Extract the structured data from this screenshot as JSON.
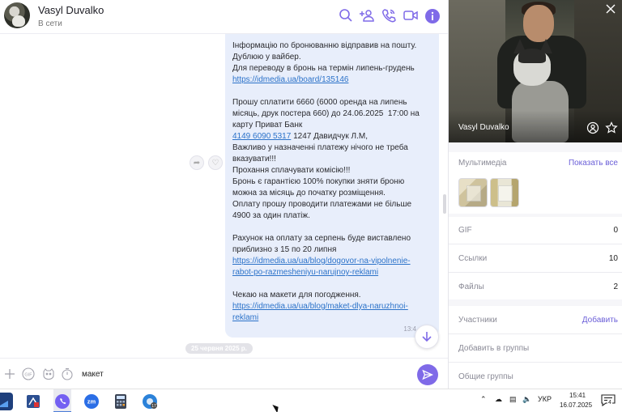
{
  "header": {
    "name": "Vasyl Duvalko",
    "status": "В сети",
    "icons": [
      "search-icon",
      "add-participant-icon",
      "call-icon",
      "video-call-icon",
      "info-icon"
    ],
    "accent": "#7f6ae8"
  },
  "message": {
    "lines": [
      {
        "text": "Інформацію по бронюванню відправив на пошту.",
        "kind": "text"
      },
      {
        "text": "Дублюю у вайбер.",
        "kind": "text"
      },
      {
        "text": "Для переводу в бронь на термін липень-грудень",
        "kind": "text"
      },
      {
        "text": "https://idmedia.ua/board/135146",
        "kind": "link"
      },
      {
        "text": "",
        "kind": "blank"
      },
      {
        "text": "Прошу сплатити 6660 (6000 оренда на липень",
        "kind": "text"
      },
      {
        "text": "місяць, друк постера 660) до 24.06.2025  17:00 на",
        "kind": "text"
      },
      {
        "text": "карту Приват Банк",
        "kind": "text"
      },
      {
        "text": "4149 6090 5317",
        "suffix": " 1247 Давидчук Л.М,",
        "kind": "card"
      },
      {
        "text": "Важливо у назначенні платежу нічого не треба",
        "kind": "text"
      },
      {
        "text": "вказувати!!!",
        "kind": "text"
      },
      {
        "text": "Прохання сплачувати комісію!!!",
        "kind": "text"
      },
      {
        "text": "Бронь є гарантією 100% покупки зняти броню",
        "kind": "text"
      },
      {
        "text": "можна за місяць до початку розміщення.",
        "kind": "text"
      },
      {
        "text": "Оплату прошу проводити платежами не більше",
        "kind": "text"
      },
      {
        "text": "4900 за один платіж.",
        "kind": "text"
      },
      {
        "text": "",
        "kind": "blank"
      },
      {
        "text": "Рахунок на оплату за серпень буде виставлено",
        "kind": "text"
      },
      {
        "text": "приблизно з 15 по 20 липня",
        "kind": "text"
      },
      {
        "text": "https://idmedia.ua/ua/blog/dogovor-na-vipolnenie-",
        "kind": "link"
      },
      {
        "text": "rabot-po-razmesheniyu-narujnoy-reklami",
        "kind": "link"
      },
      {
        "text": "",
        "kind": "blank"
      },
      {
        "text": "Чекаю на макети для погодження.",
        "kind": "text"
      },
      {
        "text": "https://idmedia.ua/ua/blog/maket-dlya-naruzhnoi-",
        "kind": "link"
      },
      {
        "text": "reklami",
        "kind": "link"
      }
    ],
    "time": "13:4"
  },
  "date_separator": "25 червня 2025 р.",
  "composer": {
    "value": "макет",
    "icons": [
      "plus-icon",
      "gif-icon",
      "sticker-icon",
      "timer-icon",
      "send-icon"
    ]
  },
  "panel": {
    "photo_name": "Vasyl Duvalko",
    "media_label": "Мультимедіа",
    "media_link": "Показать все",
    "gif_label": "GIF",
    "gif_count": "0",
    "links_label": "Ссылки",
    "links_count": "10",
    "files_label": "Файлы",
    "files_count": "2",
    "participants_label": "Участники",
    "participants_link": "Добавить",
    "add_to_groups": "Добавить в группы",
    "common_groups": "Общие группы"
  },
  "taskbar": {
    "apps": [
      "start-icon",
      "pdf-app-icon",
      "viber-app-icon",
      "zoom-app-icon",
      "calculator-app-icon",
      "chrome-app-icon"
    ],
    "language": "УКР",
    "time": "15:41",
    "date": "16.07.2025",
    "notifications": "4"
  }
}
